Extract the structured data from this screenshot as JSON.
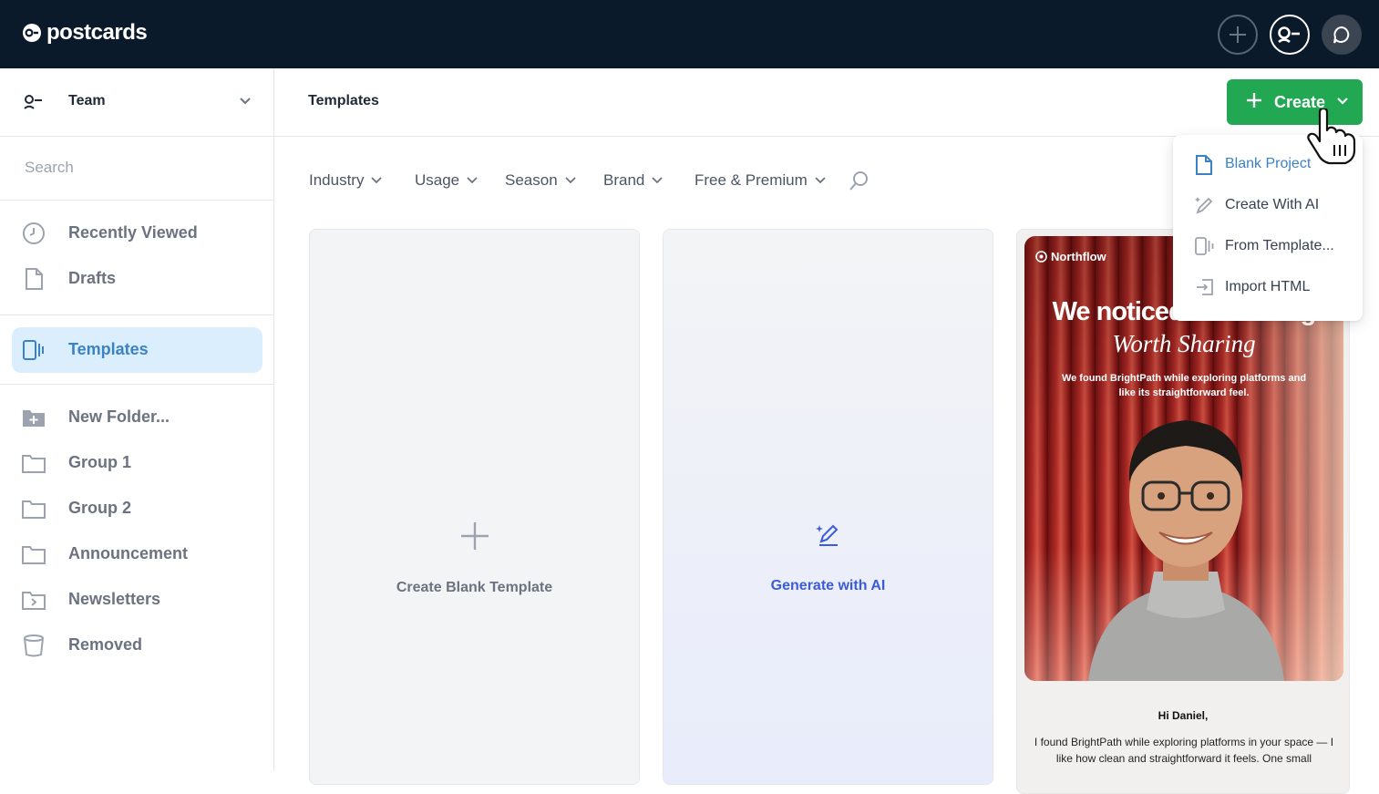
{
  "app": {
    "name": "postcards"
  },
  "sidebar": {
    "team": "Team",
    "search_placeholder": "Search",
    "items": [
      {
        "label": "Recently Viewed",
        "icon": "clock-icon"
      },
      {
        "label": "Drafts",
        "icon": "document-icon"
      },
      {
        "label": "Templates",
        "icon": "templates-icon",
        "active": true
      },
      {
        "label": "New Folder...",
        "icon": "folder-add-icon"
      },
      {
        "label": "Group 1",
        "icon": "folder-icon"
      },
      {
        "label": "Group 2",
        "icon": "folder-icon"
      },
      {
        "label": "Announcement",
        "icon": "folder-icon"
      },
      {
        "label": "Newsletters",
        "icon": "folder-shared-icon"
      },
      {
        "label": "Removed",
        "icon": "trash-icon"
      }
    ]
  },
  "header": {
    "title": "Templates",
    "create_label": "Create"
  },
  "filters": [
    "Industry",
    "Usage",
    "Season",
    "Brand",
    "Free & Premium"
  ],
  "cards": {
    "blank": "Create Blank Template",
    "ai": "Generate with AI"
  },
  "template_preview": {
    "brand": "Northflow",
    "headline": "We noticed something",
    "headline2": "Worth Sharing",
    "sub": "We found BrightPath while exploring platforms and like its straightforward feel.",
    "greeting": "Hi Daniel,",
    "body": "I found BrightPath while exploring platforms in your space — I like how clean and straightforward it feels. One small"
  },
  "create_menu": {
    "items": [
      {
        "label": "Blank Project",
        "icon": "document-icon",
        "primary": true
      },
      {
        "label": "Create With AI",
        "icon": "magic-pen-icon"
      },
      {
        "label": "From Template...",
        "icon": "templates-icon"
      },
      {
        "label": "Import HTML",
        "icon": "import-icon"
      }
    ]
  },
  "colors": {
    "topbar": "#0b1a2b",
    "accent_green": "#22a852",
    "accent_blue": "#3b82c4",
    "active_bg": "#dbeefe"
  }
}
